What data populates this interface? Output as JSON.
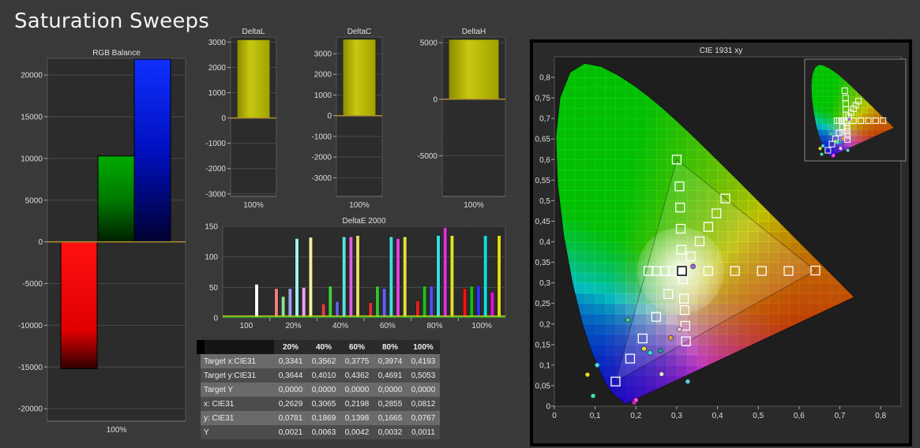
{
  "page_title": "Saturation Sweeps",
  "chart_data": [
    {
      "id": "rgb",
      "type": "bar",
      "title": "RGB Balance",
      "categories": [
        "100%"
      ],
      "series": [
        {
          "values": [
            -15200
          ],
          "color": "#ff0000"
        },
        {
          "values": [
            10300
          ],
          "color": "#00a000"
        },
        {
          "values": [
            21900
          ],
          "color": "#0000ff"
        }
      ],
      "ylim": [
        -21500,
        22000
      ],
      "yticks": [
        -20000,
        -15000,
        -10000,
        -5000,
        0,
        5000,
        10000,
        15000,
        20000
      ]
    },
    {
      "id": "deltaL",
      "type": "bar",
      "title": "DeltaL",
      "categories": [
        "100%"
      ],
      "values": [
        3100
      ],
      "ylim": [
        -3100,
        3200
      ],
      "yticks": [
        -3000,
        -2000,
        -1000,
        0,
        1000,
        2000,
        3000
      ]
    },
    {
      "id": "deltaC",
      "type": "bar",
      "title": "DeltaC",
      "categories": [
        "100%"
      ],
      "values": [
        3700
      ],
      "ylim": [
        -3900,
        3800
      ],
      "yticks": [
        -3000,
        -2000,
        -1000,
        0,
        1000,
        2000,
        3000
      ]
    },
    {
      "id": "deltaH",
      "type": "bar",
      "title": "DeltaH",
      "categories": [
        "100%"
      ],
      "values": [
        5300
      ],
      "ylim": [
        -8600,
        5500
      ],
      "yticks": [
        -5000,
        0,
        5000
      ]
    },
    {
      "id": "deltaE",
      "type": "bar",
      "title": "DeltaE 2000",
      "categories": [
        "100",
        "20%",
        "40%",
        "60%",
        "80%",
        "100%"
      ],
      "ylim": [
        0,
        150
      ],
      "yticks": [
        0,
        50,
        100,
        150
      ],
      "groups": [
        [
          {
            "v": 0,
            "c": "#ffffff"
          },
          {
            "v": 0,
            "c": "#ffffff"
          },
          {
            "v": 0,
            "c": "#ffffff"
          },
          {
            "v": 0,
            "c": "#ffffff"
          },
          {
            "v": 55,
            "c": "#ffffff"
          },
          {
            "v": 0,
            "c": "#ffffff"
          }
        ],
        [
          {
            "v": 48,
            "c": "#f08080"
          },
          {
            "v": 35,
            "c": "#90e090"
          },
          {
            "v": 48,
            "c": "#a0a0f0"
          },
          {
            "v": 130,
            "c": "#a0f0f0"
          },
          {
            "v": 50,
            "c": "#f0a0f0"
          },
          {
            "v": 132,
            "c": "#f0f0a0"
          }
        ],
        [
          {
            "v": 23,
            "c": "#e04040"
          },
          {
            "v": 52,
            "c": "#40d040"
          },
          {
            "v": 27,
            "c": "#6060e0"
          },
          {
            "v": 133,
            "c": "#60e0e0"
          },
          {
            "v": 133,
            "c": "#e060e0"
          },
          {
            "v": 135,
            "c": "#e0e060"
          }
        ],
        [
          {
            "v": 25,
            "c": "#e03030"
          },
          {
            "v": 52,
            "c": "#30c030"
          },
          {
            "v": 48,
            "c": "#6060ff"
          },
          {
            "v": 133,
            "c": "#40e0e0"
          },
          {
            "v": 130,
            "c": "#e040e0"
          },
          {
            "v": 133,
            "c": "#e0e040"
          }
        ],
        [
          {
            "v": 28,
            "c": "#e02020"
          },
          {
            "v": 52,
            "c": "#20c020"
          },
          {
            "v": 52,
            "c": "#5050ff"
          },
          {
            "v": 135,
            "c": "#30e0e0"
          },
          {
            "v": 148,
            "c": "#e030e0"
          },
          {
            "v": 135,
            "c": "#e0e030"
          }
        ],
        [
          {
            "v": 48,
            "c": "#ff1010"
          },
          {
            "v": 52,
            "c": "#10c010"
          },
          {
            "v": 53,
            "c": "#3030ff"
          },
          {
            "v": 135,
            "c": "#10e0e0"
          },
          {
            "v": 42,
            "c": "#e010e0"
          },
          {
            "v": 135,
            "c": "#e0e010"
          }
        ]
      ]
    },
    {
      "id": "cie",
      "type": "scatter",
      "title": "CIE 1931 xy",
      "xlim": [
        0,
        0.85
      ],
      "ylim": [
        0,
        0.85
      ],
      "xticks": [
        "0",
        "0,1",
        "0,2",
        "0,3",
        "0,4",
        "0,5",
        "0,6",
        "0,7",
        "0,8"
      ],
      "yticks": [
        "0",
        "0,05",
        "0,1",
        "0,15",
        "0,2",
        "0,25",
        "0,3",
        "0,35",
        "0,4",
        "0,45",
        "0,5",
        "0,55",
        "0,6",
        "0,65",
        "0,7",
        "0,75",
        "0,8"
      ],
      "gamut": [
        [
          0.64,
          0.33
        ],
        [
          0.3,
          0.6
        ],
        [
          0.15,
          0.06
        ]
      ],
      "white": [
        0.3127,
        0.329
      ],
      "targets": [
        [
          0.2306,
          0.329
        ],
        [
          0.2507,
          0.329
        ],
        [
          0.2709,
          0.329
        ],
        [
          0.2914,
          0.329
        ],
        [
          0.3127,
          0.329
        ],
        [
          0.3772,
          0.329
        ],
        [
          0.4427,
          0.329
        ],
        [
          0.5087,
          0.329
        ],
        [
          0.5741,
          0.329
        ],
        [
          0.64,
          0.33
        ],
        [
          0.3112,
          0.3805
        ],
        [
          0.3098,
          0.4317
        ],
        [
          0.3083,
          0.4834
        ],
        [
          0.3068,
          0.5348
        ],
        [
          0.3,
          0.6
        ],
        [
          0.3341,
          0.3644
        ],
        [
          0.3562,
          0.401
        ],
        [
          0.3775,
          0.4362
        ],
        [
          0.3974,
          0.4691
        ],
        [
          0.4193,
          0.5053
        ],
        [
          0.2794,
          0.2728
        ],
        [
          0.2496,
          0.2174
        ],
        [
          0.2164,
          0.1648
        ],
        [
          0.1858,
          0.1158
        ],
        [
          0.15,
          0.06
        ],
        [
          0.3155,
          0.3094
        ],
        [
          0.3178,
          0.2617
        ],
        [
          0.3193,
          0.2338
        ],
        [
          0.3209,
          0.1957
        ],
        [
          0.3227,
          0.158
        ]
      ],
      "measured": [
        {
          "x": 0.2629,
          "y": 0.0781,
          "c": "#e0e0e0"
        },
        {
          "x": 0.3065,
          "y": 0.1869,
          "c": "#f0c0e0"
        },
        {
          "x": 0.2198,
          "y": 0.1398,
          "c": "#e0e040"
        },
        {
          "x": 0.2855,
          "y": 0.1665,
          "c": "#e0a040"
        },
        {
          "x": 0.0812,
          "y": 0.0767,
          "c": "#e0e020"
        },
        {
          "x": 0.34,
          "y": 0.34,
          "c": "#a060e0"
        },
        {
          "x": 0.196,
          "y": 0.009,
          "c": "#d020d0"
        },
        {
          "x": 0.18,
          "y": 0.21,
          "c": "#40d080"
        },
        {
          "x": 0.235,
          "y": 0.13,
          "c": "#30e0e0"
        },
        {
          "x": 0.105,
          "y": 0.1,
          "c": "#40e0e0"
        },
        {
          "x": 0.095,
          "y": 0.025,
          "c": "#40e0b0"
        },
        {
          "x": 0.327,
          "y": 0.06,
          "c": "#60d0e0"
        },
        {
          "x": 0.26,
          "y": 0.135,
          "c": "#20a0a0"
        },
        {
          "x": 0.2,
          "y": 0.015,
          "c": "#ff40ff"
        }
      ]
    }
  ],
  "table": {
    "headers": [
      "20%",
      "40%",
      "60%",
      "80%",
      "100%"
    ],
    "rows": [
      {
        "label": "Target x:CIE31",
        "values": [
          "0,3341",
          "0,3562",
          "0,3775",
          "0,3974",
          "0,4193"
        ]
      },
      {
        "label": "Target y:CIE31",
        "values": [
          "0,3644",
          "0,4010",
          "0,4362",
          "0,4691",
          "0,5053"
        ]
      },
      {
        "label": "Target Y",
        "values": [
          "0,0000",
          "0,0000",
          "0,0000",
          "0,0000",
          "0,0000"
        ]
      },
      {
        "label": "x: CIE31",
        "values": [
          "0,2629",
          "0,3065",
          "0,2198",
          "0,2855",
          "0,0812"
        ]
      },
      {
        "label": "y: CIE31",
        "values": [
          "0,0781",
          "0,1869",
          "0,1398",
          "0,1665",
          "0,0767"
        ]
      },
      {
        "label": "Y",
        "values": [
          "0,0021",
          "0,0063",
          "0,0042",
          "0,0032",
          "0,0011"
        ]
      }
    ]
  }
}
